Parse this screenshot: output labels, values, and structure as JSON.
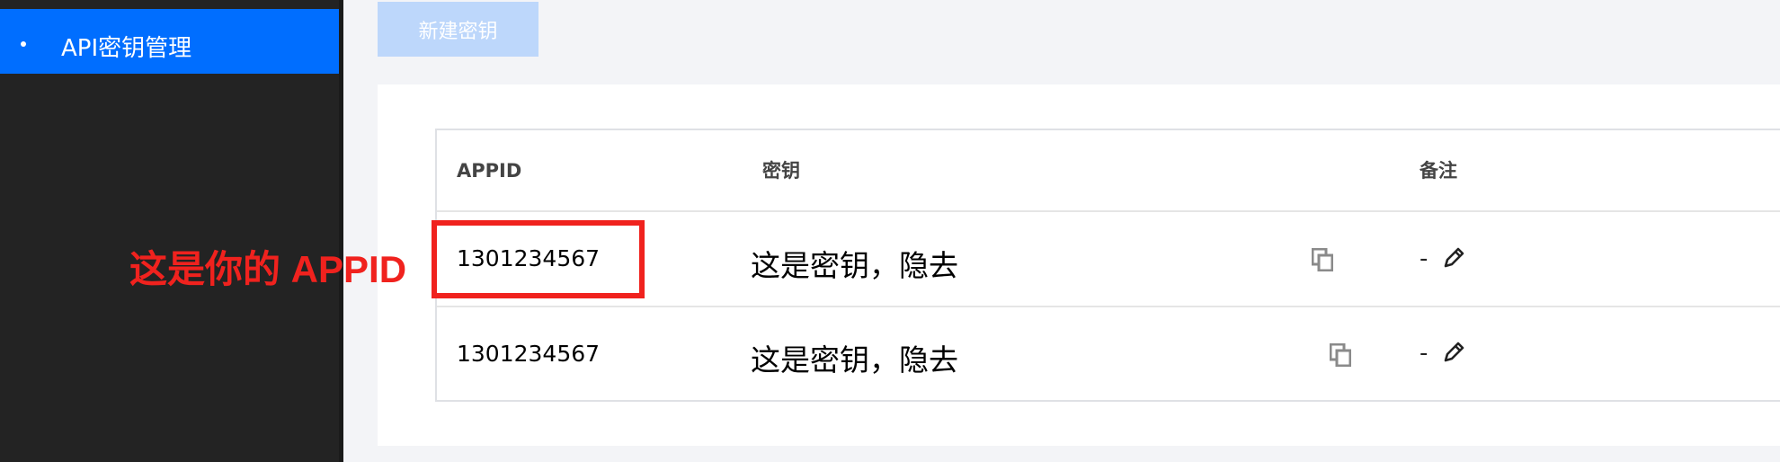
{
  "sidebar": {
    "active_item": {
      "label": "API密钥管理"
    }
  },
  "toolbar": {
    "new_key_label": "新建密钥"
  },
  "table": {
    "headers": {
      "appid": "APPID",
      "key": "密钥",
      "remark": "备注"
    },
    "rows": [
      {
        "appid": "1301234567",
        "key": "这是密钥，隐去",
        "remark": "-"
      },
      {
        "appid": "1301234567",
        "key": "这是密钥，隐去",
        "remark": "-"
      }
    ]
  },
  "annotation": {
    "label": "这是你的 APPID",
    "color": "#f0221e"
  },
  "colors": {
    "accent": "#006eff",
    "sidebar_bg": "#232323",
    "disabled_button": "#bdd7fb"
  },
  "icons": [
    "copy-icon",
    "pencil-icon"
  ]
}
